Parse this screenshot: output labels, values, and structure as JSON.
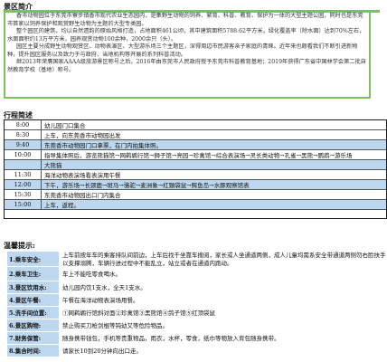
{
  "intro": {
    "title": "景区简介",
    "paragraphs": [
      "香市动物园位于东莞市寮步镇香市现代农业生态园内，是集野生动物的饲养、繁育、科普、教育、保护为一体的大型主题公园，同时也是东莞市首家以饲养保护和观赏野生动物为主题的大型专类园。",
      "整个园区的建筑，均以自然遗韵的原始风格打造，占地面积461公顷，其中建筑面积5788.62平方米，绿化覆盖率（除水面）达到70%左右，水面面积约13万平方米，园养观赏动物100余种，2000余只（头）。",
      "园区主要分成野生动物观赏区、动物表演区、大型游乐场三个主题区，深得周边市民游客亲子家庭的青睐。近年来也颇看我们不断引进新物种，提升园区服务以及致力于与政府、当地机构等开展的系列科普活动。",
      "继2013年荣膺国家AAAA级旅游景区称号之后，2016年由东莞市人民政府授予东莞市科普教育基地；2019年获得广东省中国林学会第二批自然教育学校（基地）称号。"
    ]
  },
  "schedule": {
    "title": "行程简述",
    "rows": [
      {
        "time": "8:00",
        "text": "幼儿园门口集合"
      },
      {
        "time": "8:30",
        "text": "上车，向东莞香市动物园出发"
      },
      {
        "time": "9:40",
        "text": "东莞香市动物园门口拿票，在门内拍集体照。"
      },
      {
        "time": "10:00",
        "text": "指导集体照后，游览熊猫馆→网鹈鹕行馆→狮子馆→亮园→珍禽馆→综合表演场→灵长类动物→孔雀→黑熊→鹦鹉→游乐场"
      },
      {
        "time": "",
        "text": "大熊猫"
      },
      {
        "time": "11:30",
        "text": "海洋动物表演场看表演用午餐"
      },
      {
        "time": "12:00",
        "text": "下午，游乐场→长颈鹿→斑马→骆驼→麦洲象→红頸袋鼠→鳄鱼岛→水豚观察馆表"
      },
      {
        "time": "15:30",
        "text": "东莞香市动物园出口门内集合"
      },
      {
        "time": "15:00",
        "text": "上车，返程。"
      }
    ]
  },
  "tips": {
    "title": "温馨提示:",
    "items": [
      {
        "label": "1.乘车安全:",
        "text": "上车前按年车的乘客排队间前边，上车后找千坐靠车搜阅，家长或人坐通道两侧，成人儿童均需系安全带通道两侧勿右脸扶手以支撑溺腾，车辆行进过程中不能乱立，站立或者在通道内跑动。"
      },
      {
        "label": "2.乘车卫生:",
        "text": "车上不能吃零食喝水。"
      },
      {
        "label": "3.景区饮用水:",
        "text": "幼儿园内饮1支水，全天1支水。"
      },
      {
        "label": "4.景区午餐:",
        "text": "午餐在海洋动物表演场用餐。"
      },
      {
        "label": "5.洗手间位置:",
        "text": "①网鹈鹕行馆斜对面②珍禽馆③黑熊馆④鸽子馆⑤红顶袋鼠"
      },
      {
        "label": "6.景区购物:",
        "text": "禁止购买刀枪剑棍等钝幼又等危险物品。"
      },
      {
        "label": "7.财务保管:",
        "text": "随身携带钱包，手机等贵重物品，雨衣，水杯，零食，纸巾等物放入背包随身携带。"
      },
      {
        "label": "8.集合时间:",
        "text": "请家长10到20分钟向出口走。"
      }
    ]
  },
  "colors": {
    "accent_green": "#7dc35b",
    "row_highlight": "#bdd7ee"
  }
}
